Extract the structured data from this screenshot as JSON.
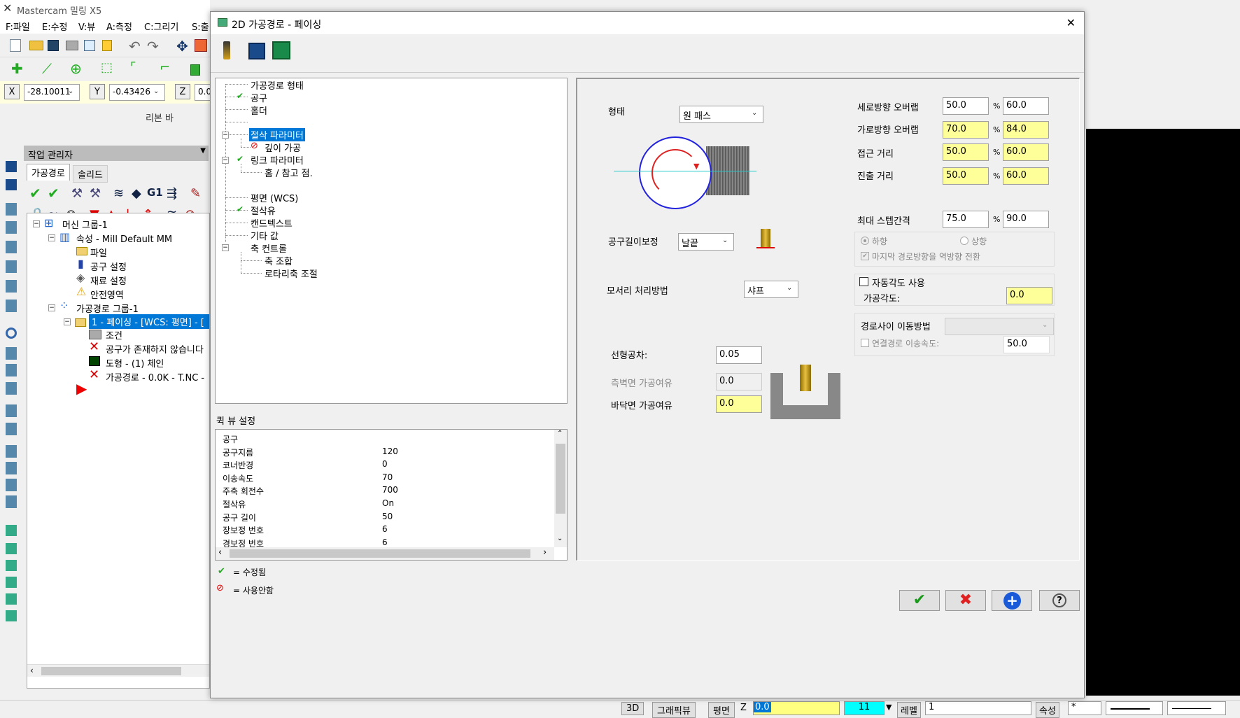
{
  "app": {
    "title": "Mastercam 밀링 X5",
    "menu": [
      "F:파일",
      "E:수정",
      "V:뷰",
      "A:측정",
      "C:그리기",
      "S:출"
    ],
    "coords": {
      "x_label": "X",
      "x_value": "-28.10011",
      "y_label": "Y",
      "y_value": "-0.43426",
      "z_label": "Z",
      "z_value": "0.0"
    },
    "ribbon_label": "리본 바"
  },
  "manager": {
    "title": "작업 관리자",
    "tabs": [
      "가공경로",
      "솔리드"
    ],
    "tree": [
      "머신 그룹-1",
      "속성 - Mill Default MM",
      "파일",
      "공구 설정",
      "재료 설정",
      "안전영역",
      "가공경로 그룹-1",
      "1 - 페이싱 - [WCS: 평면] - [",
      "조건",
      "공구가 존재하지 않습니다",
      "도형 - (1) 체인",
      "가공경로 - 0.0K - T.NC -"
    ]
  },
  "dialog": {
    "title": "2D 가공경로 - 페이싱",
    "close": "✕",
    "nav_tree": [
      "가공경로 형태",
      "공구",
      "홀더",
      "",
      "절삭 파라미터",
      "깊이 가공",
      "링크 파라미터",
      "홈 / 참고 점.",
      "",
      "평면 (WCS)",
      "절삭유",
      "캔드텍스트",
      "기타 값",
      "축 컨트롤",
      "축 조합",
      "로타리축 조절"
    ],
    "quick_view": {
      "title": "퀵 뷰 설정",
      "rows": [
        [
          "공구",
          ""
        ],
        [
          "공구지름",
          "120"
        ],
        [
          "코너반경",
          "0"
        ],
        [
          "이송속도",
          "70"
        ],
        [
          "주축 회전수",
          "700"
        ],
        [
          "절삭유",
          "On"
        ],
        [
          "공구 길이",
          "50"
        ],
        [
          "장보정 번호",
          "6"
        ],
        [
          "경보정 번호",
          "6"
        ]
      ]
    },
    "legend": {
      "modified": "= 수정됨",
      "disabled": "= 사용안함"
    },
    "params": {
      "style_label": "형태",
      "style_value": "원 패스",
      "tool_comp_label": "공구길이보정",
      "tool_comp_value": "날끝",
      "corner_label": "모서리 처리방법",
      "corner_value": "샤프",
      "linear_tol_label": "선형공차:",
      "linear_tol_value": "0.05",
      "wall_stock_label": "측벽면 가공여유",
      "wall_stock_value": "0.0",
      "floor_stock_label": "바닥면 가공여유",
      "floor_stock_value": "0.0",
      "across_overlap_label": "세로방향 오버랩",
      "across_overlap_pct": "50.0",
      "across_overlap_val": "60.0",
      "along_overlap_label": "가로방향 오버랩",
      "along_overlap_pct": "70.0",
      "along_overlap_val": "84.0",
      "approach_label": "접근 거리",
      "approach_pct": "50.0",
      "approach_val": "60.0",
      "exit_label": "진출 거리",
      "exit_pct": "50.0",
      "exit_val": "60.0",
      "max_step_label": "최대 스텝간격",
      "max_step_pct": "75.0",
      "max_step_val": "90.0",
      "pct_sign": "%",
      "down_label": "하향",
      "up_label": "상향",
      "reverse_label": "마지막 경로방향을 역방향 전환",
      "auto_angle_label": "자동각도 사용",
      "angle_label": "가공각도:",
      "angle_value": "0.0",
      "move_label": "경로사이 이동방법",
      "feed_label": "연결경로 이송속도:",
      "feed_value": "50.0"
    }
  },
  "status": {
    "btn_3d": "3D",
    "btn_graphic": "그래픽뷰",
    "btn_plane": "평면",
    "z_label": "Z",
    "z_value": "0.0",
    "level_num": "11",
    "level_label": "레벨",
    "level_value": "1",
    "attr_label": "속성",
    "star": "*"
  }
}
